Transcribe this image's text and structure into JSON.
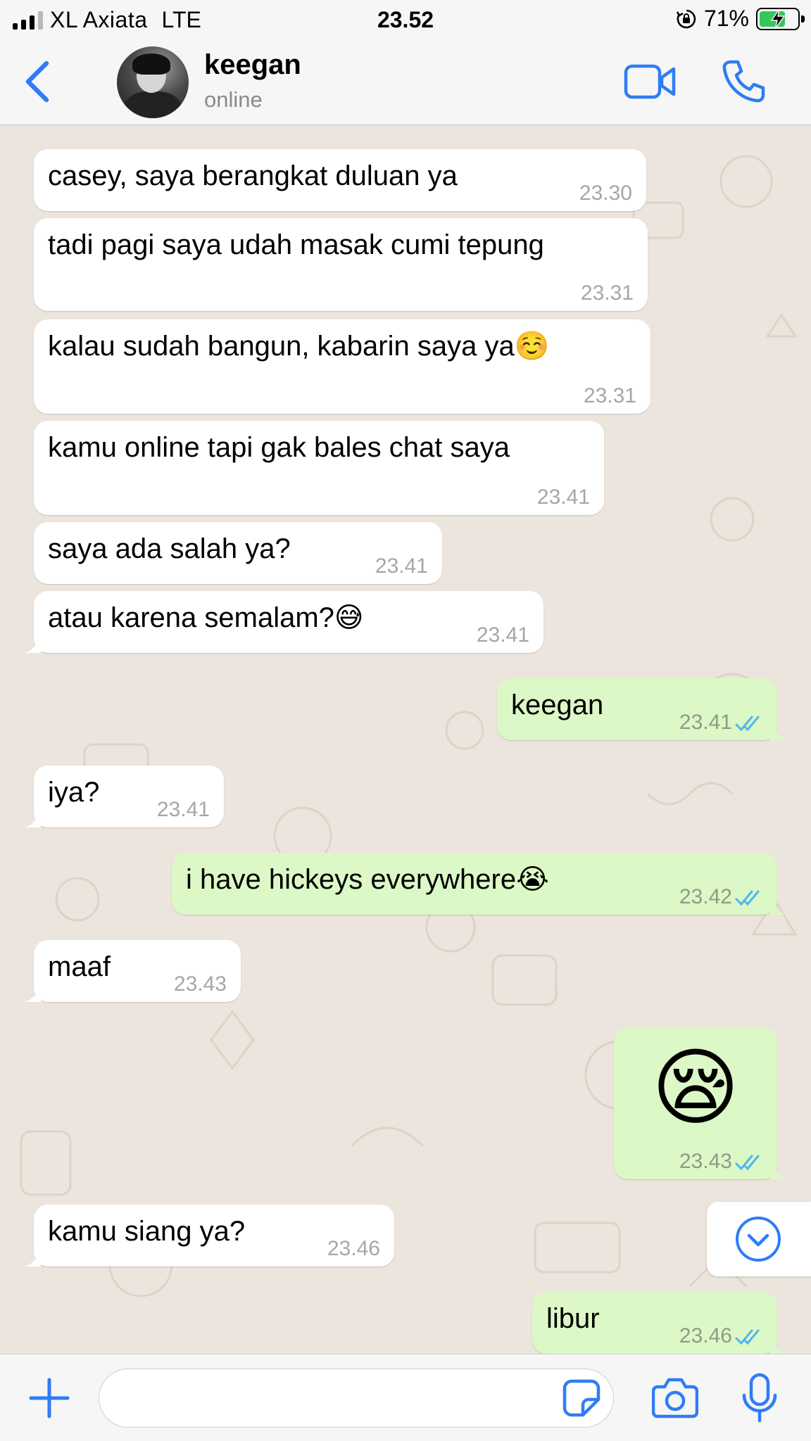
{
  "status_bar": {
    "carrier": "XL Axiata",
    "network": "LTE",
    "time": "23.52",
    "battery_percent": "71%",
    "battery_level": 0.71
  },
  "header": {
    "contact_name": "keegan",
    "contact_status": "online"
  },
  "messages": [
    {
      "direction": "incoming",
      "text": "casey, saya berangkat duluan ya",
      "time": "23.30"
    },
    {
      "direction": "incoming",
      "text": "tadi pagi saya udah masak cumi tepung",
      "time": "23.31"
    },
    {
      "direction": "incoming",
      "text": "kalau sudah bangun, kabarin saya ya☺️",
      "time": "23.31"
    },
    {
      "direction": "incoming",
      "text": "kamu online tapi gak bales chat saya",
      "time": "23.41"
    },
    {
      "direction": "incoming",
      "text": "saya ada salah ya?",
      "time": "23.41"
    },
    {
      "direction": "incoming",
      "text": "atau karena semalam?😅",
      "time": "23.41"
    },
    {
      "direction": "outgoing",
      "text": "keegan",
      "time": "23.41",
      "status": "read"
    },
    {
      "direction": "incoming",
      "text": "iya?",
      "time": "23.41"
    },
    {
      "direction": "outgoing",
      "text": "i have hickeys everywhere😭",
      "time": "23.42",
      "status": "read"
    },
    {
      "direction": "incoming",
      "text": "maaf",
      "time": "23.43"
    },
    {
      "direction": "outgoing",
      "text": "😪",
      "time": "23.43",
      "status": "read"
    },
    {
      "direction": "incoming",
      "text": "kamu siang ya?",
      "time": "23.46"
    },
    {
      "direction": "outgoing",
      "text": "libur",
      "time": "23.46",
      "status": "read"
    }
  ],
  "composer": {
    "input_value": "",
    "input_placeholder": ""
  },
  "colors": {
    "accent": "#2F7CF6",
    "incoming_bubble": "#FFFFFF",
    "outgoing_bubble": "#DCF8C6",
    "chat_background": "#ECE5DD",
    "read_ticks": "#4FB6EC",
    "battery_fill": "#34C759"
  },
  "icons": {
    "back": "chevron-left-icon",
    "video_call": "video-camera-icon",
    "voice_call": "phone-icon",
    "scroll_down": "chevron-down-circle-icon",
    "attach": "plus-icon",
    "sticker": "sticker-icon",
    "camera": "camera-icon",
    "microphone": "microphone-icon"
  }
}
